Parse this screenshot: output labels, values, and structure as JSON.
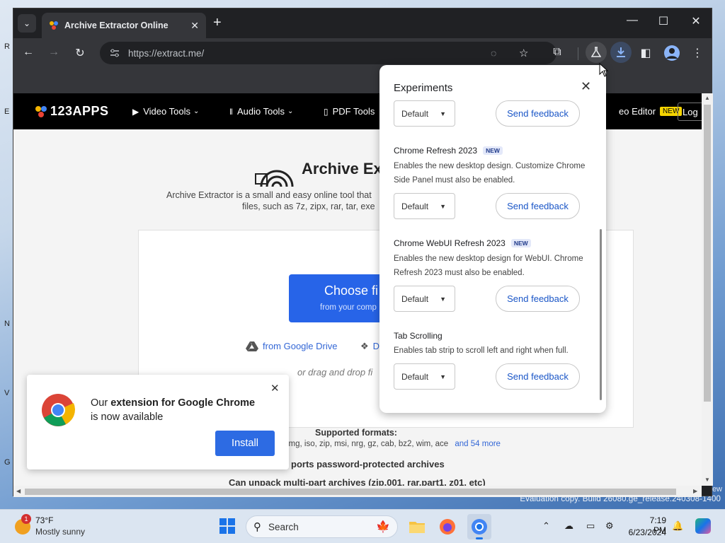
{
  "desktop": {
    "edge_letters": [
      "R",
      "E",
      "N",
      "V",
      "G"
    ],
    "watermark": "Evaluation copy. Build 26080.ge_release.240308-1400",
    "watermark_prev": "ew"
  },
  "browser": {
    "tab_title": "Archive Extractor Online",
    "url": "https://extract.me/",
    "window_controls": {
      "minimize": "—",
      "maximize": "☐",
      "close": "✕"
    }
  },
  "site": {
    "logo_text": "123APPS",
    "nav": [
      {
        "label": "Video Tools",
        "icon": "video-icon"
      },
      {
        "label": "Audio Tools",
        "icon": "audio-wave-icon"
      },
      {
        "label": "PDF Tools",
        "icon": "pdf-icon"
      }
    ],
    "nav_right_label": "eo Editor",
    "nav_new_badge": "NEW",
    "login_label": "Log",
    "hero_title": "Archive Ex",
    "hero_desc_line1": "Archive Extractor is a small and easy online tool that",
    "hero_desc_line2": "files, such as 7z, zipx, rar, tar, exe",
    "choose_label": "Choose fi",
    "choose_sub": "from your comp",
    "gdrive_label": "from Google Drive",
    "dropbox_label": "D",
    "drag_text": "or drag and drop fi",
    "formats_title": "Supported formats:",
    "formats_list": "img, iso, zip, msi, nrg, gz, cab, bz2, wim, ace",
    "formats_more": "and 54 more",
    "password_text": "ports password-protected archives",
    "multipart_text": "Can unpack multi-part archives (zip.001, rar.part1, z01, etc)"
  },
  "toast": {
    "text_pre": "Our ",
    "text_bold": "extension for Google Chrome",
    "text_post": " is now available",
    "install_label": "Install",
    "close_label": "✕"
  },
  "experiments": {
    "title": "Experiments",
    "close_label": "✕",
    "items": [
      {
        "name": "",
        "new": "",
        "desc": "",
        "select": "Default",
        "feedback": "Send feedback"
      },
      {
        "name": "Chrome Refresh 2023",
        "new": "NEW",
        "desc": "Enables the new desktop design. Customize Chrome Side Panel must also be enabled.",
        "select": "Default",
        "feedback": "Send feedback"
      },
      {
        "name": "Chrome WebUI Refresh 2023",
        "new": "NEW",
        "desc": "Enables the new desktop design for WebUI. Chrome Refresh 2023 must also be enabled.",
        "select": "Default",
        "feedback": "Send feedback"
      },
      {
        "name": "Tab Scrolling",
        "new": "",
        "desc": "Enables tab strip to scroll left and right when full.",
        "select": "Default",
        "feedback": "Send feedback"
      }
    ]
  },
  "taskbar": {
    "weather_badge": "1",
    "temperature": "73°F",
    "condition": "Mostly sunny",
    "search_label": "Search",
    "time": "7:19 PM",
    "date": "6/23/2024"
  },
  "colors": {
    "accent": "#2764e8",
    "chrome_dark": "#35363a",
    "toast_button": "#2d6be3"
  }
}
